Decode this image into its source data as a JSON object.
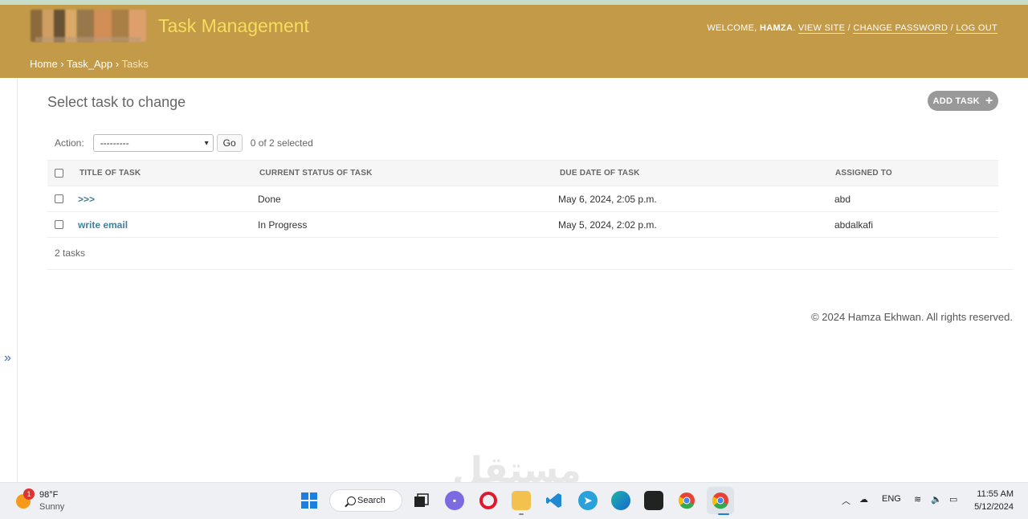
{
  "header": {
    "site_title": "Task Management",
    "user_tools": {
      "welcome": "WELCOME,",
      "username": "HAMZA",
      "view_site": "VIEW SITE",
      "change_password": "CHANGE PASSWORD",
      "log_out": "LOG OUT",
      "separator": "/"
    },
    "breadcrumbs": {
      "home": "Home",
      "app": "Task_App",
      "current": "Tasks",
      "separator": "›"
    }
  },
  "sidebar": {
    "toggle_glyph": "»"
  },
  "content": {
    "title": "Select task to change",
    "add_button": "ADD TASK",
    "add_icon": "+",
    "action_label": "Action:",
    "action_selected": "---------",
    "go_button": "Go",
    "selection_count": "0 of 2 selected",
    "columns": [
      "TITLE OF TASK",
      "CURRENT STATUS OF TASK",
      "DUE DATE OF TASK",
      "ASSIGNED TO"
    ],
    "rows": [
      {
        "title": ">>>",
        "status": "Done",
        "due": "May 6, 2024, 2:05 p.m.",
        "assigned": "abd"
      },
      {
        "title": "write email",
        "status": "In Progress",
        "due": "May 5, 2024, 2:02 p.m.",
        "assigned": "abdalkafi"
      }
    ],
    "total": "2 tasks"
  },
  "footer": {
    "copyright": "© 2024 Hamza Ekhwan. All rights reserved."
  },
  "watermark": "مستقل",
  "taskbar": {
    "weather_temp": "98°F",
    "weather_condition": "Sunny",
    "notification_count": "1",
    "search_label": "Search",
    "language": "ENG",
    "time": "11:55 AM",
    "date": "5/12/2024",
    "icons": [
      "windows-start-icon",
      "search-icon",
      "task-view-icon",
      "teams-chat-icon",
      "opera-icon",
      "file-explorer-icon",
      "vscode-icon",
      "telegram-icon",
      "edge-icon",
      "store-icon",
      "chrome-icon",
      "chrome-active-icon"
    ]
  },
  "colors": {
    "header_bg": "#c29a48",
    "site_title": "#f5dd5d",
    "link": "#447e9b",
    "button_grey": "#999999"
  }
}
